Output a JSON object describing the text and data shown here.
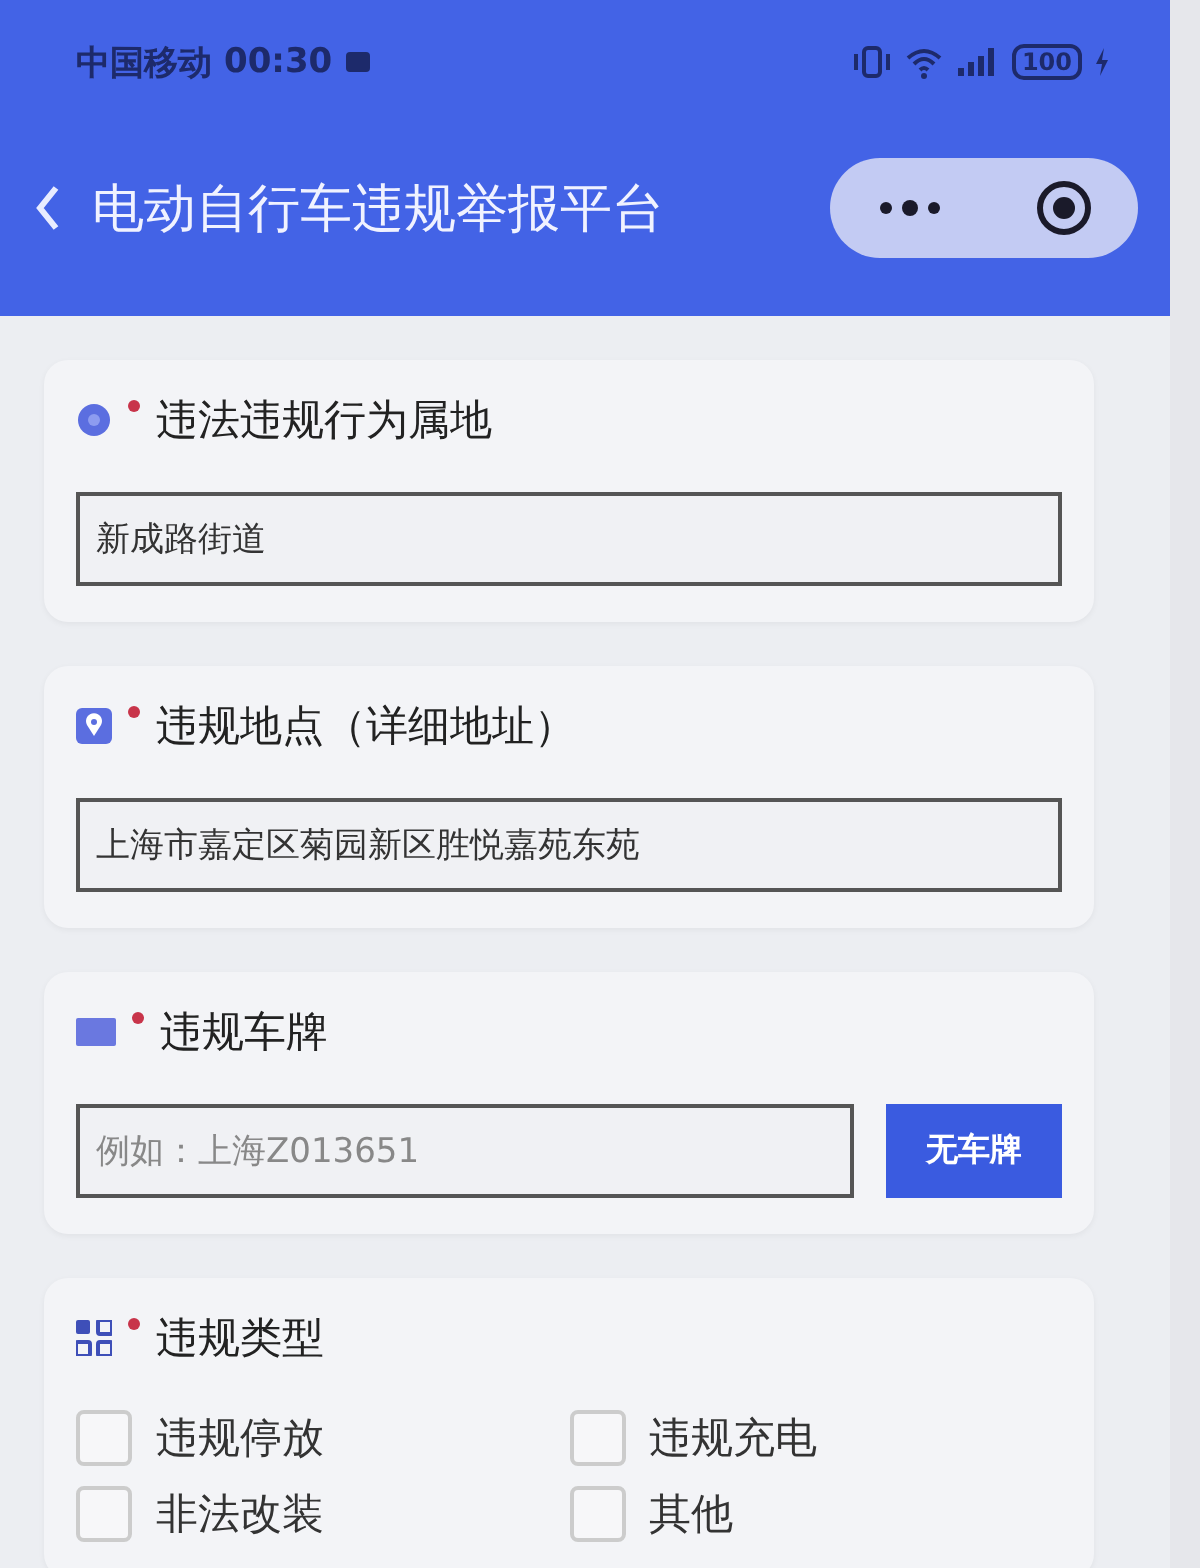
{
  "status_bar": {
    "carrier": "中国移动",
    "time": "00:30",
    "battery": "100"
  },
  "header": {
    "title": "电动自行车违规举报平台"
  },
  "sections": [
    {
      "kind": "text",
      "label": "违法违规行为属地",
      "required": true,
      "value": "新成路街道"
    },
    {
      "kind": "text",
      "label": "违规地点（详细地址）",
      "required": true,
      "value": "上海市嘉定区菊园新区胜悦嘉苑东苑"
    },
    {
      "kind": "plate",
      "label": "违规车牌",
      "required": true,
      "placeholder": "例如：上海Z013651",
      "button": "无车牌"
    },
    {
      "kind": "checks",
      "label": "违规类型",
      "required": true,
      "options": [
        {
          "label": "违规停放",
          "checked": false
        },
        {
          "label": "违规充电",
          "checked": false
        },
        {
          "label": "非法改装",
          "checked": false
        },
        {
          "label": "其他",
          "checked": false
        }
      ]
    }
  ]
}
